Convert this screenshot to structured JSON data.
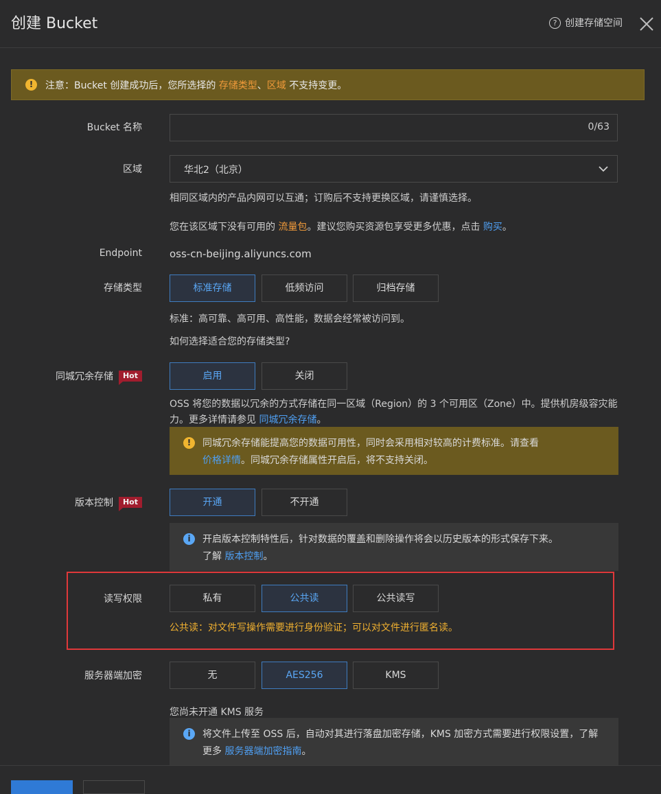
{
  "header": {
    "title": "创建 Bucket",
    "help_label": "创建存储空间"
  },
  "notice": {
    "prefix": "注意：Bucket 创建成功后，您所选择的 ",
    "link1": "存储类型",
    "sep": "、",
    "link2": "区域",
    "suffix": " 不支持变更。"
  },
  "bucket_name": {
    "label": "Bucket 名称",
    "value": "",
    "counter": "0/63"
  },
  "region": {
    "label": "区域",
    "selected": "华北2（北京）",
    "hint1": "相同区域内的产品内网可以互通；订购后不支持更换区域，请谨慎选择。",
    "hint2_prefix": "您在该区域下没有可用的 ",
    "hint2_link1": "流量包",
    "hint2_mid": "。建议您购买资源包享受更多优惠，点击 ",
    "hint2_link2": "购买",
    "hint2_suffix": "。"
  },
  "endpoint": {
    "label": "Endpoint",
    "value": "oss-cn-beijing.aliyuncs.com"
  },
  "storage_class": {
    "label": "存储类型",
    "options": [
      "标准存储",
      "低频访问",
      "归档存储"
    ],
    "selected_index": 0,
    "desc": "标准：高可靠、高可用、高性能，数据会经常被访问到。",
    "help_link": "如何选择适合您的存储类型?"
  },
  "zrs": {
    "label": "同城冗余存储",
    "badge": "Hot",
    "options": [
      "启用",
      "关闭"
    ],
    "selected_index": 0,
    "desc_prefix": "OSS 将您的数据以冗余的方式存储在同一区域（Region）的 3 个可用区（Zone）中。提供机房级容灾能力。更多详情请参见 ",
    "desc_link": "同城冗余存储",
    "desc_suffix": "。",
    "warn_prefix": "同城冗余存储能提高您的数据可用性，同时会采用相对较高的计费标准。请查看",
    "warn_link": "价格详情",
    "warn_suffix": "。同城冗余存储属性开启后，将不支持关闭。"
  },
  "versioning": {
    "label": "版本控制",
    "badge": "Hot",
    "options": [
      "开通",
      "不开通"
    ],
    "selected_index": 0,
    "info_line1": "开启版本控制特性后，针对数据的覆盖和删除操作将会以历史版本的形式保存下来。",
    "info_line2_prefix": "了解 ",
    "info_link": "版本控制",
    "info_suffix": "。"
  },
  "acl": {
    "label": "读写权限",
    "options": [
      "私有",
      "公共读",
      "公共读写"
    ],
    "selected_index": 1,
    "desc": "公共读：对文件写操作需要进行身份验证；可以对文件进行匿名读。"
  },
  "encryption": {
    "label": "服务器端加密",
    "options": [
      "无",
      "AES256",
      "KMS"
    ],
    "selected_index": 1,
    "kms_status": "您尚未开通 KMS 服务",
    "info_prefix": "将文件上传至 OSS 后，自动对其进行落盘加密存储，KMS 加密方式需要进行权限设置，了解更多 ",
    "info_link": "服务器端加密指南",
    "info_suffix": "。"
  },
  "colors": {
    "accent": "#5aa7f5",
    "warning_bg": "#6b5a1f",
    "hot_badge": "#a11d2e",
    "highlight": "#e0383a"
  }
}
